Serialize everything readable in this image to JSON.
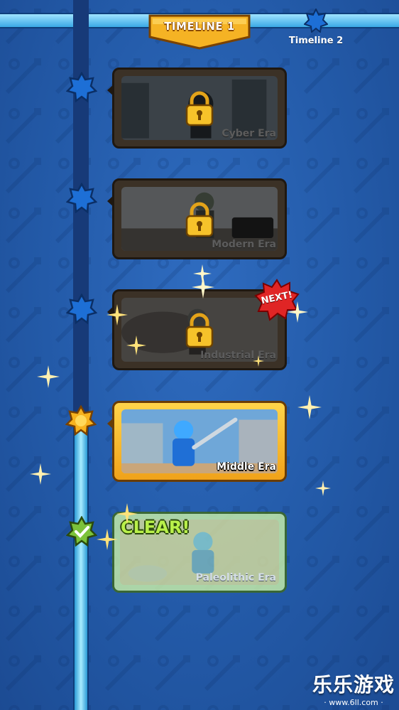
{
  "header": {
    "active_tab": "TIMELINE 1",
    "next_tab": "Timeline 2"
  },
  "eras": [
    {
      "label": "Cyber Era",
      "state": "locked"
    },
    {
      "label": "Modern Era",
      "state": "locked"
    },
    {
      "label": "Industrial Era",
      "state": "locked",
      "badge": "NEXT!"
    },
    {
      "label": "Middle Era",
      "state": "current"
    },
    {
      "label": "Paleolithic Era",
      "state": "cleared",
      "badge": "CLEAR!"
    }
  ],
  "watermark": {
    "text": "乐乐游戏",
    "url": "· www.6ll.com ·"
  },
  "colors": {
    "background": "#235aa8",
    "active_tab": "#f5b324",
    "current_card": "#ffc83a",
    "cleared_card": "#c9f0a8",
    "next_badge": "#d92020"
  },
  "icons": [
    "star-node-icon",
    "sun-node-icon",
    "check-node-icon",
    "lock-icon",
    "sparkle-icon"
  ]
}
